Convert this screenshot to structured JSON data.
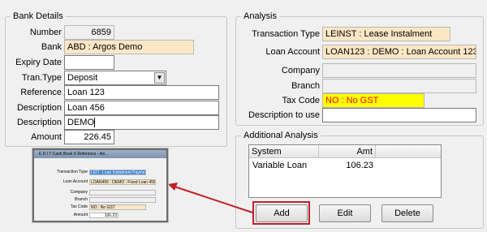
{
  "bank_details": {
    "title": "Bank Details",
    "number_label": "Number",
    "number_value": "6859",
    "bank_label": "Bank",
    "bank_value": "ABD : Argos Demo",
    "expiry_label": "Expiry Date",
    "expiry_value": "",
    "trantype_label": "Tran.Type",
    "trantype_value": "Deposit",
    "reference_label": "Reference",
    "reference_value": "Loan 123",
    "description1_label": "Description",
    "description1_value": "Loan 456",
    "description2_label": "Description",
    "description2_value": "DEMO",
    "amount_label": "Amount",
    "amount_value": "226.45"
  },
  "analysis": {
    "title": "Analysis",
    "transaction_type_label": "Transaction Type",
    "transaction_type_value": "LEINST : Lease Instalment",
    "loan_account_label": "Loan Account",
    "loan_account_value": "LOAN123 : DEMO : Loan Account 123",
    "company_label": "Company",
    "company_value": "",
    "branch_label": "Branch",
    "branch_value": "",
    "tax_code_label": "Tax Code",
    "tax_code_value": "NO : No GST",
    "description_to_use_label": "Description to use",
    "description_to_use_value": ""
  },
  "additional_analysis": {
    "title": "Additional Analysis",
    "columns": [
      "System",
      "Amt"
    ],
    "rows": [
      {
        "system": "Variable Loan",
        "amt": "106.23"
      }
    ],
    "add_label": "Add",
    "edit_label": "Edit",
    "delete_label": "Delete"
  },
  "thumbnail": {
    "title": "E D I T  Cash Book X Reference - Ad...",
    "transaction_type_label": "Transaction Type",
    "transaction_type_value": "LEO : Loan Instalment Payment",
    "loan_account_label": "Loan Account",
    "loan_account_value": "LOAN456 : DEMO : Fixed Loan 456",
    "company_label": "Company",
    "branch_label": "Branch",
    "tax_code_label": "Tax Code",
    "tax_code_value": "NO : No GST",
    "amount_label": "Amount",
    "amount_value": "106.23"
  },
  "colors": {
    "highlight_box": "#c0202a",
    "arrow": "#c0202a",
    "tan_field": "#fce7c5",
    "yellow_field": "#ffff00"
  }
}
